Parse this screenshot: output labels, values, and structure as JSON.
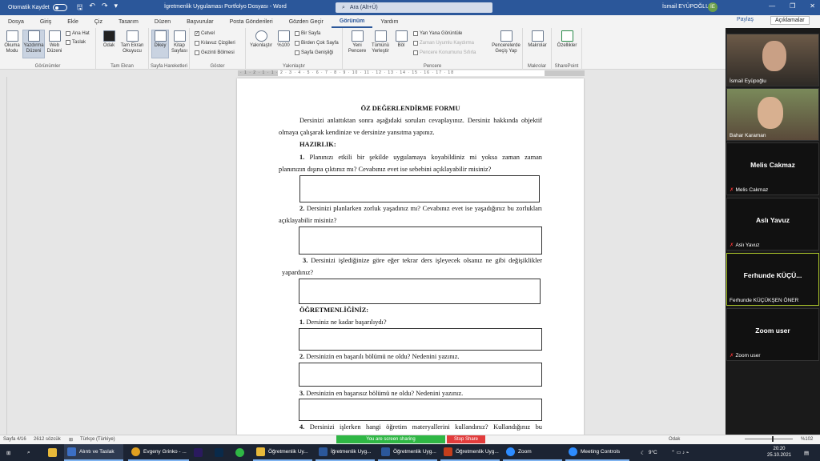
{
  "titlebar": {
    "autosave_label": "Otomatik Kaydet",
    "doc_title": "İgretmenlik Uygulaması Portfolyo Dosyası - Word",
    "search_placeholder": "Ara (Alt+Ü)",
    "user_name": "İsmail EYÜPOĞLU",
    "user_initials": "İE",
    "minimize": "—",
    "restore": "❐",
    "close": "✕"
  },
  "menu": {
    "tabs": [
      "Dosya",
      "Giriş",
      "Ekle",
      "Çiz",
      "Tasarım",
      "Düzen",
      "Başvurular",
      "Posta Gönderileri",
      "Gözden Geçir",
      "Görünüm",
      "Yardım"
    ],
    "share": "Paylaş",
    "comments": "Açıklamalar"
  },
  "ribbon": {
    "views": {
      "label": "Görünümler",
      "okuma": "Okuma Modu",
      "yazdirma": "Yazdırma Düzeni",
      "web": "Web Düzeni",
      "anahat": "Ana Hat",
      "taslak": "Taslak"
    },
    "immersive": {
      "label": "Tam Ekran",
      "odak": "Odak",
      "tamekran": "Tam Ekran Okuyucu"
    },
    "pagemove": {
      "label": "Sayfa Hareketleri",
      "dikey": "Dikey",
      "kitap": "Kitap Sayfası"
    },
    "show": {
      "label": "Göster",
      "cetvel": "Cetvel",
      "kilavuz": "Kılavuz Çizgileri",
      "gezinti": "Gezinti Bölmesi"
    },
    "zoom": {
      "label": "Yakınlaştır",
      "yakinlastir": "Yakınlaştır",
      "yuz": "%100",
      "bir": "Bir Sayfa",
      "birden": "Birden Çok Sayfa",
      "genislik": "Sayfa Genişliği"
    },
    "window": {
      "label": "Pencere",
      "yeni": "Yeni Pencere",
      "tumunu": "Tümünü Yerleştir",
      "bol": "Böl",
      "yanyana": "Yan Yana Görüntüle",
      "zaman": "Zaman Uyumlu Kaydırma",
      "sifirla": "Pencere Konumunu Sıfırla",
      "gecis": "Pencerelerde Geçiş Yap"
    },
    "macros": {
      "label": "Makrolar",
      "makrolar": "Makrolar"
    },
    "sharepoint": {
      "label": "SharePoint",
      "ozellikler": "Özellikler"
    }
  },
  "ruler": {
    "numbers": "· 1 · 2 · 1 · 1 · 2 · 3 · 4 · 5 · 6 · 7 · 8 · 9 · 10 · 11 · 12 · 13 · 14 · 15 · 16 · 17 · 18"
  },
  "document": {
    "title": "ÖZ DEĞERLENDİRME FORMU",
    "intro1": "Dersinizi anlattıktan sonra aşağıdaki soruları cevaplayınız. Dersiniz hakkında objektif",
    "intro2": "olmaya çalışarak kendinize ve dersinize yansıtma yapınız.",
    "h_hazirlik": "HAZIRLIK:",
    "q1_num": "1.",
    "q1a": "Planınızı etkili bir şekilde uygulamaya koyabildiniz mi yoksa zaman zaman",
    "q1b": "planınızın dışına çıktınız mı? Cevabınız evet ise sebebini açıklayabilir misiniz?",
    "q2_num": "2.",
    "q2a": "Dersinizi planlarken zorluk yaşadınız mı? Cevabınız evet ise yaşadığınız bu zorlukları",
    "q2b": "açıklayabilir misiniz?",
    "q3_num": "3.",
    "q3a": "Dersinizi işlediğinize göre eğer tekrar ders işleyecek olsanız ne gibi değişiklikler",
    "q3b": "yapardınız?",
    "h_ogretmenlik": "ÖĞRETMENLİĞİNİZ:",
    "o1_num": "1.",
    "o1": "Dersiniz ne kadar başarılıydı?",
    "o2_num": "2.",
    "o2": "Dersinizin en başarılı bölümü ne oldu? Nedenini yazınız.",
    "o3_num": "3.",
    "o3": "Dersinizin en başarısız bölümü ne oldu? Nedenini yazınız.",
    "o4_num": "4.",
    "o4": "Dersinizi işlerken hangi öğretim materyallerini kullandınız? Kullandığınız bu"
  },
  "status": {
    "page": "Sayfa 4/16",
    "words": "2612 sözcük",
    "lang": "Türkçe (Türkiye)",
    "screen_sharing": "You are screen sharing",
    "stop_share": "Stop Share",
    "focus": "Odak",
    "zoom": "%102"
  },
  "participants": [
    {
      "name": "İsmail Eyüpoğlu",
      "video": true
    },
    {
      "name": "Bahar Karaman",
      "video": true
    },
    {
      "display": "Melis Cakmaz",
      "name": "Melis Cakmaz",
      "video": false
    },
    {
      "display": "Aslı Yavuz",
      "name": "Aslı Yavuz",
      "video": false
    },
    {
      "display": "Ferhunde  KÜÇÜ...",
      "name": "Ferhunde KÜÇÜKŞEN ÖNER",
      "video": false
    },
    {
      "display": "Zoom user",
      "name": "Zoom user",
      "video": false
    }
  ],
  "taskbar": {
    "items": [
      "Alıntı ve Taslak",
      "Evgeny Grinko - ...",
      "Öğretmenlik Uy...",
      "İğretmenlik Uyg...",
      "Öğretmenlik Uyg...",
      "Öğretmenlik Uyg...",
      "Zoom",
      "Meeting Controls"
    ],
    "weather": "9°C",
    "time": "20:20",
    "date": "25.10.2021"
  },
  "colors": {
    "word_blue": "#2b579a",
    "share_green": "#2fb745",
    "stop_red": "#e23c3c",
    "taskbar": "#1c2433"
  }
}
